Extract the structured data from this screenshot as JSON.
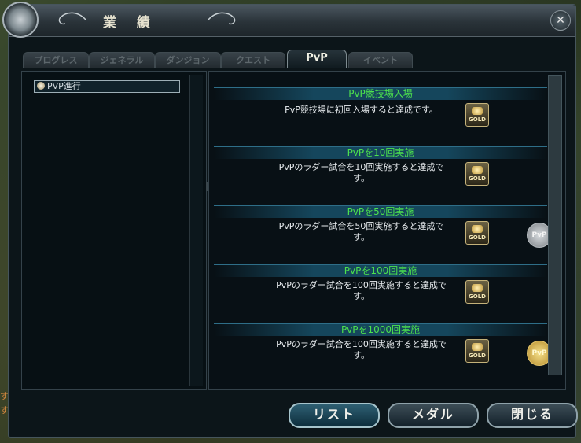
{
  "window": {
    "title": "業 績",
    "close_glyph": "✕"
  },
  "tabs": [
    {
      "label": "プログレス",
      "active": false
    },
    {
      "label": "ジェネラル",
      "active": false
    },
    {
      "label": "ダンジョン",
      "active": false
    },
    {
      "label": "クエスト",
      "active": false
    },
    {
      "label": "PvP",
      "active": true
    },
    {
      "label": "イベント",
      "active": false
    }
  ],
  "tree": {
    "selected_label": "PVP進行",
    "icon": "helmet-icon"
  },
  "achievements": [
    {
      "title": "PvP競技場入場",
      "description_line1": "PvP競技場に初回入場すると達成です。",
      "description_line2": "",
      "reward": "GOLD",
      "medal": ""
    },
    {
      "title": "PvPを10回実施",
      "description_line1": "PvPのラダー試合を10回実施すると達成で",
      "description_line2": "す。",
      "reward": "GOLD",
      "medal": ""
    },
    {
      "title": "PvPを50回実施",
      "description_line1": "PvPのラダー試合を50回実施すると達成で",
      "description_line2": "す。",
      "reward": "GOLD",
      "medal": "PvP"
    },
    {
      "title": "PvPを100回実施",
      "description_line1": "PvPのラダー試合を100回実施すると達成で",
      "description_line2": "す。",
      "reward": "GOLD",
      "medal": ""
    },
    {
      "title": "PvPを1000回実施",
      "description_line1": "PvPのラダー試合を100回実施すると達成で",
      "description_line2": "す。",
      "reward": "GOLD",
      "medal": "PvP"
    }
  ],
  "buttons": {
    "list": "リスト",
    "medal": "メダル",
    "close": "閉じる"
  },
  "background_text": [
    "す。",
    "す。"
  ],
  "colors": {
    "achievement_title": "#4de34d",
    "active_tab_text": "#f2f2e6"
  }
}
